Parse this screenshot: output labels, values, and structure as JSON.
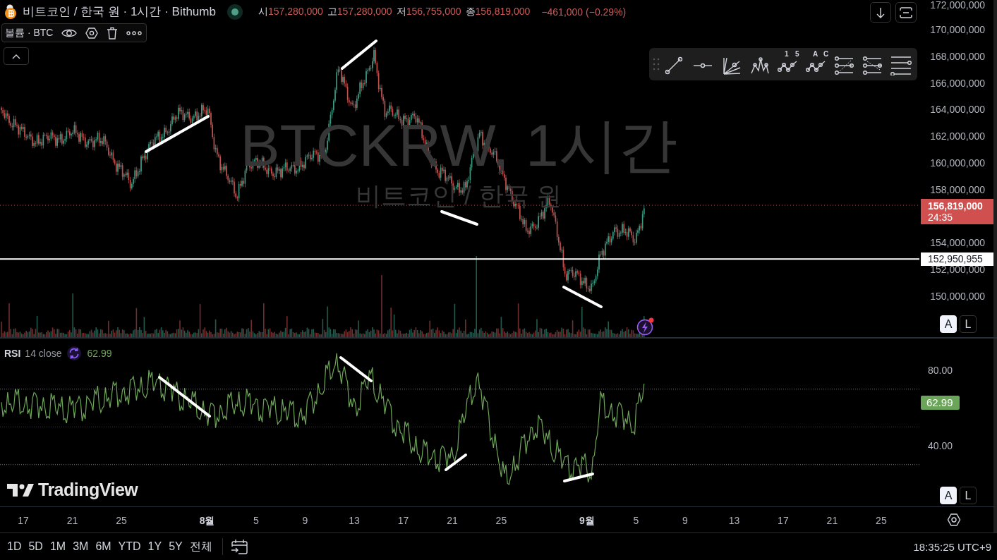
{
  "symbol": {
    "title": "비트코인 / 한국 원 · 1시간 · Bithumb",
    "market_open": true,
    "ohlc": [
      {
        "label": "시",
        "value": "157,280,000"
      },
      {
        "label": "고",
        "value": "157,280,000"
      },
      {
        "label": "저",
        "value": "156,755,000"
      },
      {
        "label": "종",
        "value": "156,819,000"
      }
    ],
    "change": "−461,000 (−0.29%)"
  },
  "volume_legend": {
    "label": "볼륨 · BTC"
  },
  "watermark": {
    "symbol": "BTCKRW, 1시간",
    "name": "비트코인 / 한국 원"
  },
  "drawing_toolbar": {
    "tools": [
      {
        "kind": "trend"
      },
      {
        "kind": "ray"
      },
      {
        "kind": "fan"
      },
      {
        "kind": "pattern"
      },
      {
        "kind": "wave",
        "labels": [
          "1",
          "5"
        ]
      },
      {
        "kind": "wave",
        "labels": [
          "A",
          "C"
        ]
      },
      {
        "kind": "channel"
      },
      {
        "kind": "regression"
      },
      {
        "kind": "lines"
      }
    ]
  },
  "price_axis": {
    "ticks": [
      "172,000,000",
      "170,000,000",
      "168,000,000",
      "166,000,000",
      "164,000,000",
      "162,000,000",
      "160,000,000",
      "158,000,000",
      "154,000,000",
      "152,000,000",
      "150,000,000"
    ],
    "last_price": {
      "value": "156,819,000",
      "countdown": "24:35"
    },
    "line_label": "152,950,955"
  },
  "price_scale_buttons": [
    {
      "label": "A",
      "selected": true
    },
    {
      "label": "L",
      "selected": false
    }
  ],
  "rsi": {
    "name": "RSI",
    "params": "14 close",
    "value": "62.99",
    "axis_ticks": [
      "80.00",
      "40.00"
    ],
    "last_value": "62.99"
  },
  "rsi_scale_buttons": [
    {
      "label": "A",
      "selected": true
    },
    {
      "label": "L",
      "selected": false
    }
  ],
  "logo": "TradingView",
  "time_axis": {
    "ticks": [
      {
        "label": "17",
        "month": false
      },
      {
        "label": "21",
        "month": false
      },
      {
        "label": "25",
        "month": false
      },
      {
        "label": "8월",
        "month": true
      },
      {
        "label": "5",
        "month": false
      },
      {
        "label": "9",
        "month": false
      },
      {
        "label": "13",
        "month": false
      },
      {
        "label": "17",
        "month": false
      },
      {
        "label": "21",
        "month": false
      },
      {
        "label": "25",
        "month": false
      },
      {
        "label": "9월",
        "month": true
      },
      {
        "label": "5",
        "month": false
      },
      {
        "label": "9",
        "month": false
      },
      {
        "label": "13",
        "month": false
      },
      {
        "label": "17",
        "month": false
      },
      {
        "label": "21",
        "month": false
      },
      {
        "label": "25",
        "month": false
      }
    ]
  },
  "bottom_bar": {
    "ranges": [
      "1D",
      "5D",
      "1M",
      "3M",
      "6M",
      "YTD",
      "1Y",
      "5Y",
      "전체"
    ],
    "clock": "18:35:25 UTC+9"
  }
}
